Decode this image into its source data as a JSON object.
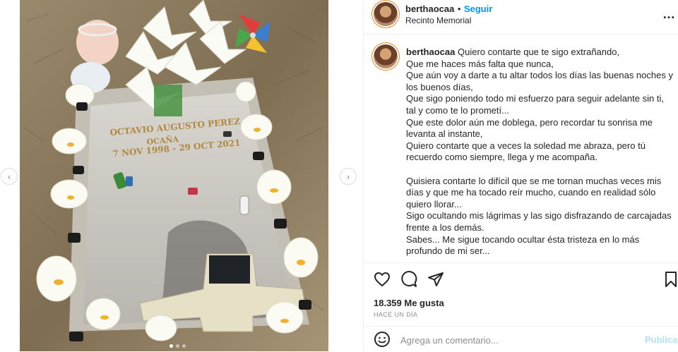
{
  "post": {
    "username": "berthaocaa",
    "separator": "•",
    "follow_label": "Seguir",
    "location": "Recinto Memorial",
    "more_icon": "more-horizontal-icon"
  },
  "photo": {
    "description_icon": "memorial-photo",
    "epitaph_name_line1": "OCTAVIO AUGUSTO PEREZ",
    "epitaph_name_line2": "OCAÑA",
    "epitaph_dates": "7 NOV 1998 - 29 OCT 2021",
    "prev_icon": "chevron-left-icon",
    "next_icon": "chevron-right-icon"
  },
  "caption": {
    "username": "berthaocaa",
    "lines": [
      "Quiero contarte que te sigo extrañando,",
      "Que me haces más falta que nunca,",
      "Que aún voy a darte a tu altar todos los días las buenas noches y los buenos días,",
      "Que sigo poniendo todo mi esfuerzo para seguir adelante sin ti, tal y como te lo prometí...",
      "Que este dolor aún me doblega, pero recordar tu sonrisa me levanta al instante,",
      "Quiero contarte que a veces la soledad me abraza, pero tú recuerdo como siempre, llega y me acompaña.",
      "",
      "Quisiera contarte lo difícil que se me tornan muchas veces mis días y que me ha tocado reír mucho, cuando en realidad sólo quiero llorar...",
      "Sigo ocultando mis lágrimas y las sigo disfrazando de carcajadas frente a los demás.",
      "Sabes... Me sigue tocando ocultar ésta tristeza en lo más profundo de mi ser..."
    ]
  },
  "actions": {
    "like_icon": "heart-icon",
    "comment_icon": "comment-icon",
    "share_icon": "send-icon",
    "save_icon": "bookmark-icon"
  },
  "stats": {
    "likes": "18.359 Me gusta",
    "date": "HACE UN DÍA"
  },
  "comment": {
    "emoji_icon": "emoji-icon",
    "placeholder": "Agrega un comentario...",
    "publish_label": "Publicar"
  },
  "colors": {
    "accent": "#0095f6",
    "publish_disabled": "#b2dffc",
    "text": "#262626",
    "muted": "#8e8e8e",
    "border": "#efefef"
  }
}
